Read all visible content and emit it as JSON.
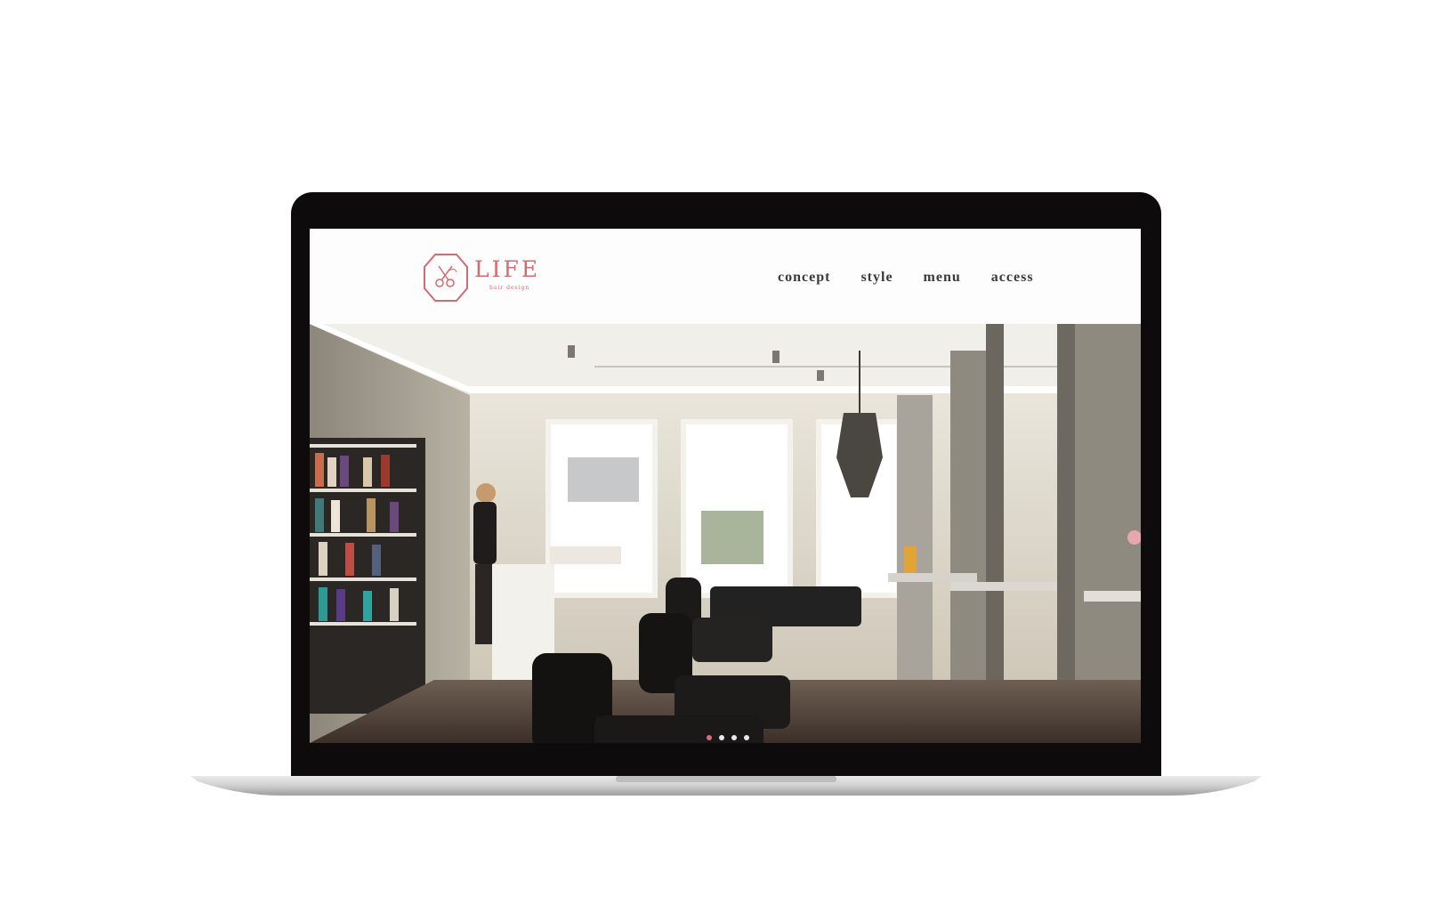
{
  "logo": {
    "wordmark": "LIFE",
    "tagline": "hair design",
    "brand_color": "#d46a72"
  },
  "nav": {
    "items": [
      {
        "label": "concept"
      },
      {
        "label": "style"
      },
      {
        "label": "menu"
      },
      {
        "label": "access"
      }
    ]
  },
  "hero": {
    "slides_total": 4,
    "active_slide": 1
  },
  "colors": {
    "lid": "#0d0b0b",
    "header_bg": "#fdfdfd",
    "nav_text": "#3a3a3a",
    "dot_active": "#e06a78"
  }
}
